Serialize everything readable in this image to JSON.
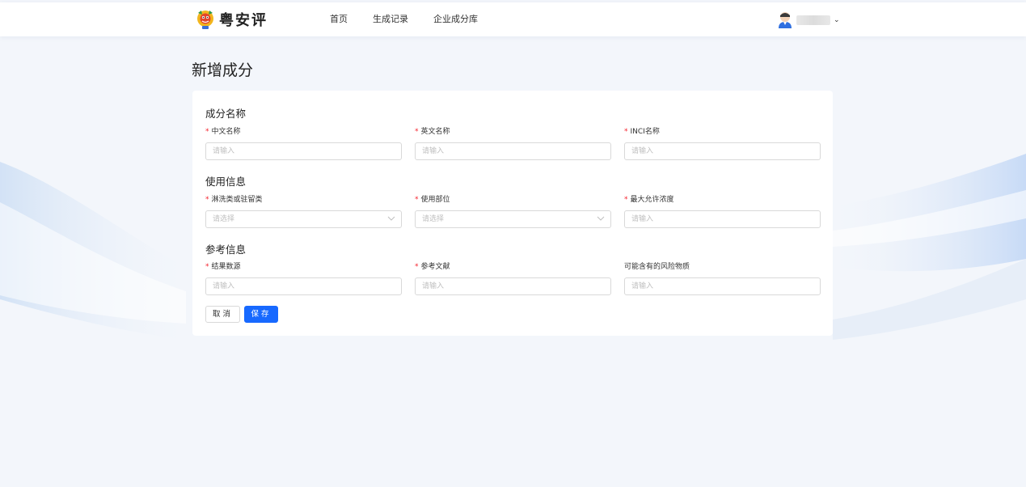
{
  "header": {
    "brand": "粤安评",
    "nav": [
      "首页",
      "生成记录",
      "企业成分库"
    ],
    "user_caret": "⌄"
  },
  "page": {
    "title": "新增成分"
  },
  "form": {
    "sections": [
      {
        "title": "成分名称",
        "fields": [
          {
            "label": "中文名称",
            "required": true,
            "type": "input",
            "placeholder": "请输入"
          },
          {
            "label": "英文名称",
            "required": true,
            "type": "input",
            "placeholder": "请输入"
          },
          {
            "label": "INCI名称",
            "required": true,
            "type": "input",
            "placeholder": "请输入"
          }
        ]
      },
      {
        "title": "使用信息",
        "fields": [
          {
            "label": "淋洗类或驻留类",
            "required": true,
            "type": "select",
            "placeholder": "请选择"
          },
          {
            "label": "使用部位",
            "required": true,
            "type": "select",
            "placeholder": "请选择"
          },
          {
            "label": "最大允许浓度",
            "required": true,
            "type": "input",
            "placeholder": "请输入"
          }
        ]
      },
      {
        "title": "参考信息",
        "fields": [
          {
            "label": "结果数源",
            "required": true,
            "type": "input",
            "placeholder": "请输入"
          },
          {
            "label": "参考文献",
            "required": true,
            "type": "input",
            "placeholder": "请输入"
          },
          {
            "label": "可能含有的风险物质",
            "required": false,
            "type": "input",
            "placeholder": "请输入"
          }
        ]
      }
    ],
    "required_mark": "*",
    "buttons": {
      "cancel": "取消",
      "save": "保存"
    }
  },
  "colors": {
    "primary": "#1769ff",
    "required": "#f5222d",
    "background": "#f3f6fb"
  }
}
